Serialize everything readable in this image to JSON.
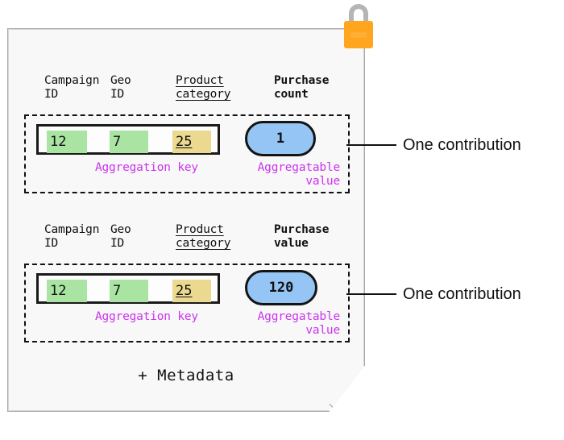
{
  "diagram": {
    "card": {
      "metadata_label": "+ Metadata",
      "lock_icon": "padlock-icon",
      "lock_body_color": "#FFA51E",
      "lock_shackle_color": "#b5b5b5",
      "background_color": "#f8f8f8",
      "border_color": "#a8a8a8"
    },
    "colors": {
      "aggregation_key_highlight": "#a9e4a3",
      "product_category_highlight": "#ead98e",
      "aggregatable_value_fill": "#95c5f4",
      "annotation_purple": "#cc33ee",
      "outline_black": "#111111"
    },
    "contributions": [
      {
        "headers": [
          {
            "label": "Campaign\nID",
            "style": "plain"
          },
          {
            "label": "Geo\nID",
            "style": "plain"
          },
          {
            "label": "Product\ncategory",
            "style": "underline"
          },
          {
            "label": "Purchase\ncount",
            "style": "bold"
          }
        ],
        "key_cells": [
          "12",
          "7",
          "25"
        ],
        "aggregatable_value": "1",
        "key_annotation": "Aggregation key",
        "value_annotation": "Aggregatable\nvalue",
        "callout": "One contribution"
      },
      {
        "headers": [
          {
            "label": "Campaign\nID",
            "style": "plain"
          },
          {
            "label": "Geo\nID",
            "style": "plain"
          },
          {
            "label": "Product\ncategory",
            "style": "underline"
          },
          {
            "label": "Purchase\nvalue",
            "style": "bold"
          }
        ],
        "key_cells": [
          "12",
          "7",
          "25"
        ],
        "aggregatable_value": "120",
        "key_annotation": "Aggregation key",
        "value_annotation": "Aggregatable\nvalue",
        "callout": "One contribution"
      }
    ]
  }
}
